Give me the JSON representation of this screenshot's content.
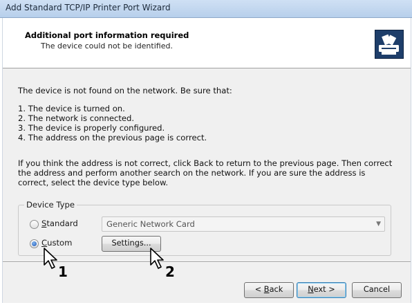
{
  "window": {
    "title": "Add Standard TCP/IP Printer Port Wizard"
  },
  "header": {
    "title": "Additional port information required",
    "subtitle": "The device could not be identified."
  },
  "body": {
    "intro": "The device is not found on the network.  Be sure that:",
    "items": [
      "1.  The device is turned on.",
      "2.  The network is connected.",
      "3.  The device is properly configured.",
      "4.  The address on the previous page is correct."
    ],
    "help": "If you think the address is not correct, click Back to return to the previous page.  Then correct the address and perform another search on the network.  If you are sure the address is correct, select the device type below."
  },
  "device_type": {
    "legend": "Device Type",
    "standard": {
      "label_accel": "S",
      "label_rest": "tandard",
      "checked": false
    },
    "custom": {
      "label_accel": "C",
      "label_rest": "ustom",
      "checked": true
    },
    "combo_value": "Generic Network Card",
    "settings_label": "Settings..."
  },
  "footer": {
    "back_accel": "B",
    "back_prefix": "< ",
    "back_rest": "ack",
    "next_accel": "N",
    "next_rest": "ext >",
    "cancel": "Cancel"
  },
  "callouts": {
    "one": "1",
    "two": "2"
  },
  "icons": {
    "header_icon": "printer-icon",
    "dropdown_arrow": "chevron-down-icon",
    "pointer": "mouse-pointer-icon"
  }
}
